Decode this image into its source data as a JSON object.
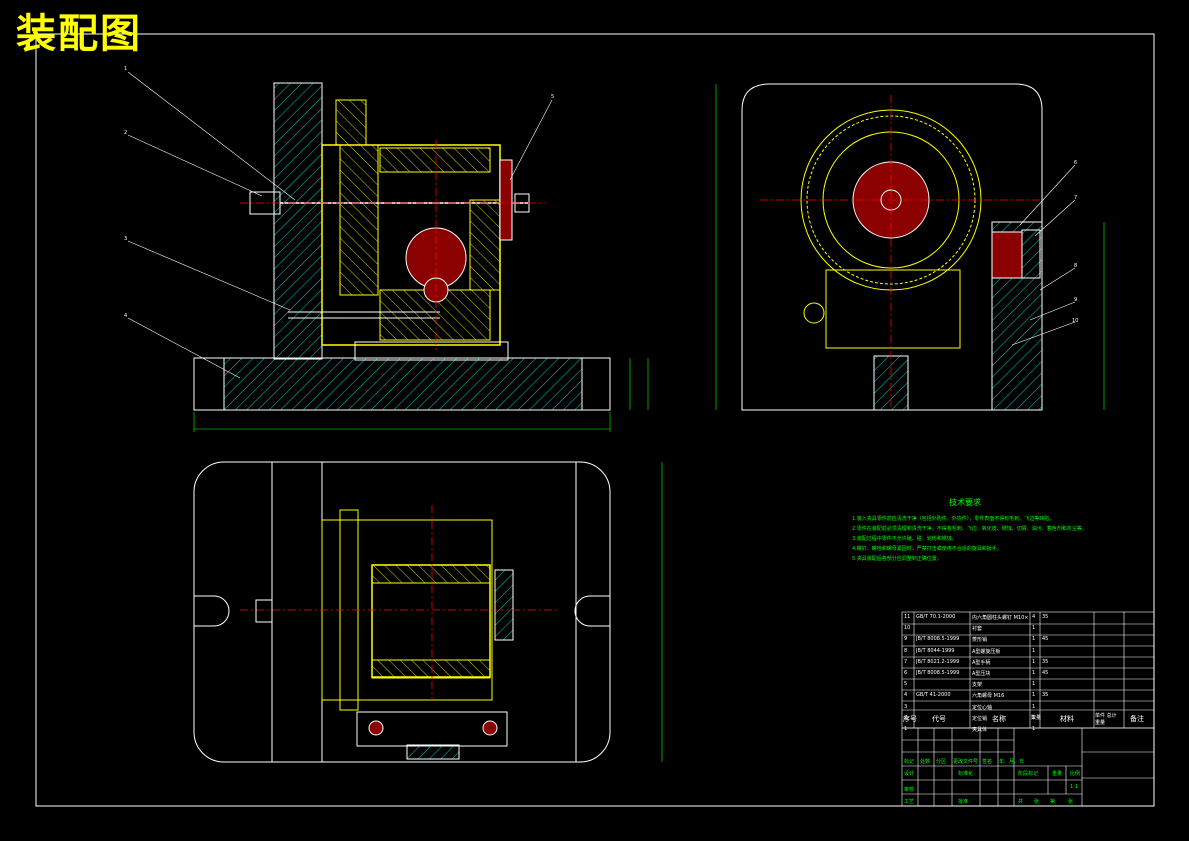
{
  "title": "装配图",
  "technical_requirements": {
    "heading": "技术要求",
    "lines": [
      "1.装入夹具零件前应清洗干净（包括外购件、外协件），零件表面不得有毛刺、飞边等缺陷。",
      "2.零件在装配前必须清理和清洗干净，不得有毛刺、飞边、氧化皮、锈蚀、切屑、油污、着色剂和灰尘等。",
      "3.装配过程中零件不允许磕、碰、划伤和锈蚀。",
      "4.螺钉、螺栓和螺母紧固时，严禁打击或使用不合适的旋具和扳手。",
      "5.夹具装配后各部分应调整到正确位置。"
    ]
  },
  "bom": {
    "rows": [
      {
        "no": "11",
        "code": "GB/T 70.1-2000",
        "name": "内六角圆柱头螺钉 M10×25",
        "qty": "4",
        "material": "35"
      },
      {
        "no": "10",
        "code": "",
        "name": "衬套",
        "qty": "1",
        "material": ""
      },
      {
        "no": "9",
        "code": "JB/T 8008.5-1999",
        "name": "菱形销",
        "qty": "1",
        "material": "45"
      },
      {
        "no": "8",
        "code": "JB/T 8044-1999",
        "name": "A型螺旋压板",
        "qty": "1",
        "material": ""
      },
      {
        "no": "7",
        "code": "JB/T 8021.2-1999",
        "name": "A型手柄",
        "qty": "1",
        "material": "35"
      },
      {
        "no": "6",
        "code": "JB/T 8008.5-1999",
        "name": "A型压块",
        "qty": "1",
        "material": "45"
      },
      {
        "no": "5",
        "code": "",
        "name": "支架",
        "qty": "1",
        "material": ""
      },
      {
        "no": "4",
        "code": "GB/T 41-2000",
        "name": "六角螺母 M16",
        "qty": "1",
        "material": "35"
      },
      {
        "no": "3",
        "code": "",
        "name": "定位心轴",
        "qty": "1",
        "material": ""
      },
      {
        "no": "2",
        "code": "",
        "name": "定位销",
        "qty": "1",
        "material": ""
      },
      {
        "no": "1",
        "code": "",
        "name": "夹具体",
        "qty": "1",
        "material": ""
      }
    ],
    "headers": {
      "no": "序号",
      "code": "代号",
      "name": "名称",
      "qty": "数量",
      "material": "材料",
      "weight": "单件 总计 重量",
      "remark": "备注"
    }
  },
  "title_block": {
    "row_labels": [
      "标记",
      "设计",
      "审核",
      "工艺"
    ],
    "col_labels": [
      "处数",
      "分区",
      "更改文件号",
      "签名",
      "年、月、日"
    ],
    "standardization": "标准化",
    "approve": "批准",
    "stage_labels": [
      "阶段标记",
      "重量",
      "比例"
    ],
    "scale": "1:1",
    "sheet_labels": [
      "共",
      "张",
      "第",
      "张"
    ]
  },
  "leaders": [
    "1",
    "2",
    "3",
    "4",
    "5",
    "6",
    "7",
    "8",
    "9",
    "10"
  ],
  "colors": {
    "background": "#000000",
    "outline": "#ffffff",
    "part_yellow": "#ffff00",
    "hatch_cyan": "#00ffff",
    "dim_green": "#00ff00",
    "center_red": "#ff0000",
    "magenta": "#ff00ff",
    "brown": "#8b0000"
  }
}
